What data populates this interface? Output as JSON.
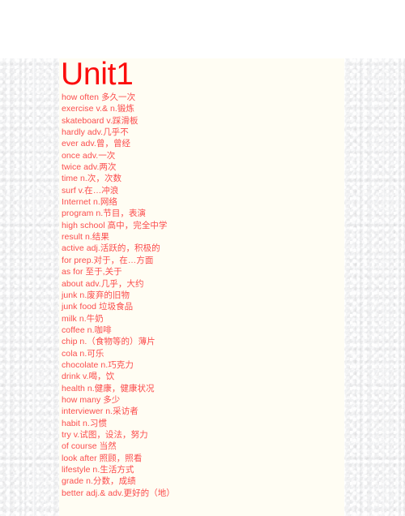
{
  "document": {
    "title": "Unit1",
    "title_color": "#fb0d0d",
    "entry_color": "#fb4d4d",
    "page_color": "#fffdf3",
    "backdrop_color": "#f4f5f7",
    "entries": [
      "how often 多久一次",
      "exercise  v.& n.锻炼",
      "skateboard   v.踩滑板",
      "hardly    adv.几乎不",
      "ever  adv.曾，曾经",
      "once   adv.一次",
      "twice   adv.两次",
      "time n.次，次数",
      "surf v.在…冲浪",
      "Internet  n.网络",
      "program n.节目，表演",
      "high school 高中，完全中学",
      "result  n.结果",
      "active adj.活跃的，积极的",
      "for prep.对于，在…方面",
      "as for 至于,关于",
      "about adv.几乎，大约",
      "junk n.废弃的旧物",
      "junk food 垃圾食品",
      "milk n.牛奶",
      "coffee n.咖啡",
      "chip n.（食物等的）薄片",
      "cola n.可乐",
      "chocolate n.巧克力",
      "drink v.喝，饮",
      "health n.健康，健康状况",
      "how many 多少",
      "interviewer  n.采访者",
      "habit n.习惯",
      "try v.试图，设法，努力",
      "of course 当然",
      "look after 照顾，照看",
      "lifestyle  n.生活方式",
      "grade n.分数，成绩",
      "better adj.& adv.更好的（地）"
    ]
  }
}
